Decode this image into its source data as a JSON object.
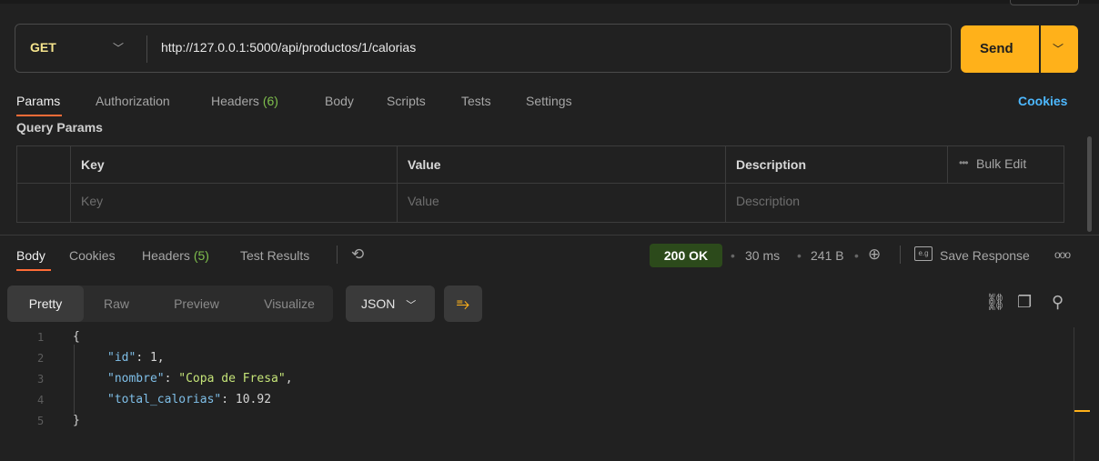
{
  "request": {
    "method": "GET",
    "url": "http://127.0.0.1:5000/api/productos/1/calorias",
    "send_label": "Send"
  },
  "request_tabs": {
    "params": "Params",
    "authorization": "Authorization",
    "headers": "Headers",
    "headers_count": "(6)",
    "body": "Body",
    "scripts": "Scripts",
    "tests": "Tests",
    "settings": "Settings",
    "cookies": "Cookies"
  },
  "query_params": {
    "title": "Query Params",
    "columns": [
      "Key",
      "Value",
      "Description"
    ],
    "placeholders": [
      "Key",
      "Value",
      "Description"
    ],
    "bulk_edit": "Bulk Edit"
  },
  "response_tabs": {
    "body": "Body",
    "cookies": "Cookies",
    "headers": "Headers",
    "headers_count": "(5)",
    "test_results": "Test Results"
  },
  "response_meta": {
    "status": "200 OK",
    "time": "30 ms",
    "size": "241 B",
    "save_response": "Save Response"
  },
  "view_tabs": [
    "Pretty",
    "Raw",
    "Preview",
    "Visualize"
  ],
  "format": "JSON",
  "code_lines": {
    "line_numbers": [
      "1",
      "2",
      "3",
      "4",
      "5"
    ],
    "open": "{",
    "id_key": "\"id\"",
    "id_val": "1",
    "nombre_key": "\"nombre\"",
    "nombre_val": "\"Copa de Fresa\"",
    "cal_key": "\"total_calorias\"",
    "cal_val": "10.92",
    "close": "}"
  },
  "colors": {
    "accent": "#ff6c37",
    "send": "#ffb11a",
    "status_ok": "#2c4a1b",
    "link": "#4db8ff"
  }
}
